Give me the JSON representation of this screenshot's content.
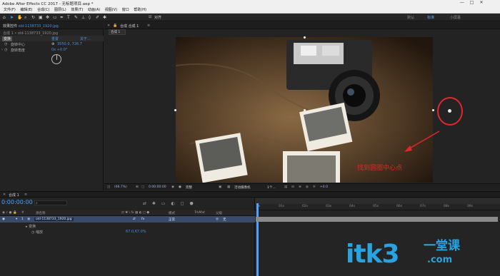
{
  "window": {
    "title": "Adobe After Effects CC 2017 - 无标题项目.aep *",
    "controls": [
      "—",
      "□",
      "✕"
    ]
  },
  "menu": [
    "文件(F)",
    "编辑(E)",
    "合成(C)",
    "图层(L)",
    "效果(T)",
    "动画(A)",
    "视图(V)",
    "窗口",
    "帮助(H)"
  ],
  "toolbar": {
    "snap_label": "对齐",
    "workspace_default": "默认",
    "workspace_standard": "标准",
    "workspace_small": "小屏幕"
  },
  "effects_panel": {
    "tab_prefix": "效果控件",
    "tab_file": "old-1138733_1920.jpg",
    "breadcrumb": "合成 1 • old-1138733_1920.jpg",
    "fx_name": "变换",
    "reset": "重置",
    "about": "关于...",
    "anchor_label": "旋转中心",
    "anchor_value": "3550.0, 726.7",
    "angle_label": "旋转角度",
    "angle_value": "0x +0.0°"
  },
  "composition": {
    "tab_label": "合成 合成 1",
    "subtab": "合成 1",
    "annotation_text": "找到圆圈中心点",
    "colors": {
      "annotation_red": "#e2262c"
    }
  },
  "comp_footer": {
    "zoom": "(66.7%)",
    "time": "0:00:00:00",
    "resolution": "完整",
    "camera": "活动摄像机",
    "views": "1个...",
    "exposure": "+0.0"
  },
  "timeline": {
    "tab_label": "合成 1",
    "current_time": "0:00:00:00",
    "headers": {
      "source": "源名称",
      "mode": "模式",
      "trkmat": "TrkMat",
      "parent": "父级"
    },
    "layer": {
      "index": "1",
      "name": "old-1138733_1920.jpg",
      "mode": "正常",
      "parent": "无"
    },
    "sublayer": {
      "label": "变换",
      "scale_label": "缩放",
      "scale_value": "67.0,67.0%"
    },
    "ruler_ticks": [
      "0s",
      "01s",
      "02s",
      "03s",
      "04s",
      "05s",
      "06s",
      "07s",
      "08s",
      "09s"
    ]
  },
  "watermark": {
    "main": "itk3",
    "cn": "一堂课",
    "domain": ".com"
  }
}
